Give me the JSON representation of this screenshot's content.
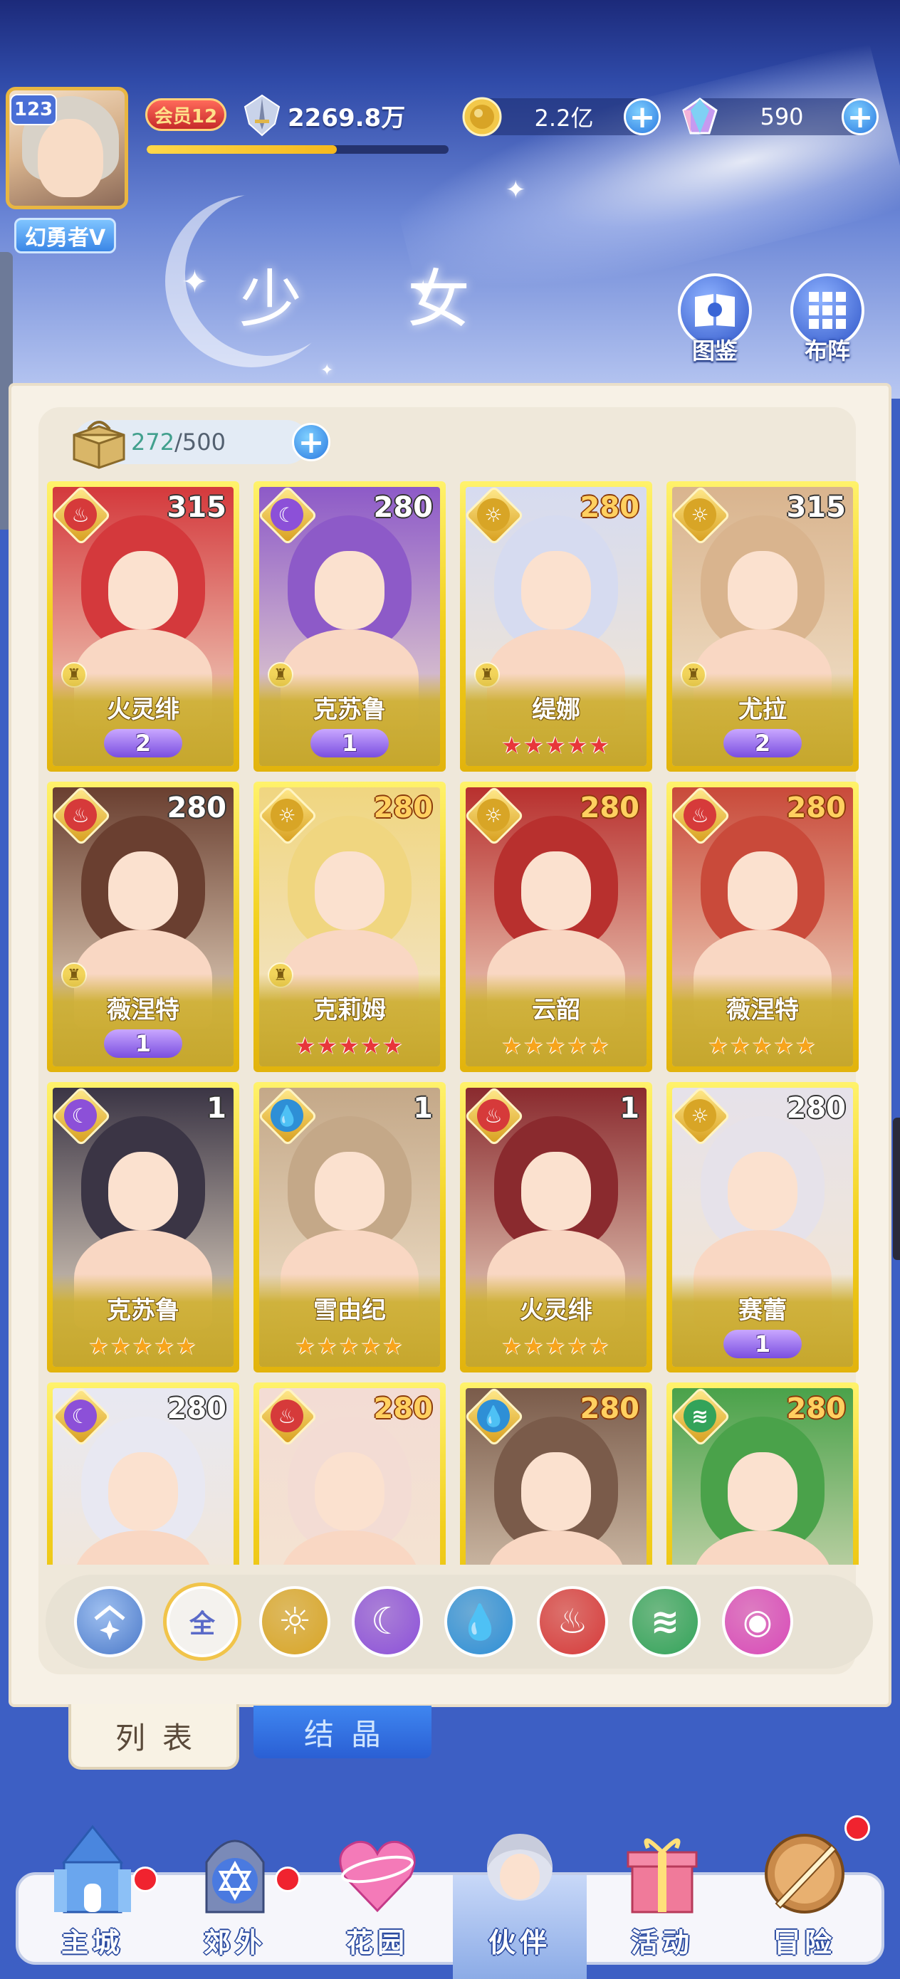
{
  "page": {
    "title": "少 女"
  },
  "player": {
    "level": "123",
    "name": "幻勇者V",
    "vip": "会员12",
    "power": "2269.8万",
    "exp_fraction": 0.63
  },
  "currencies": {
    "gold": {
      "value": "2.2亿",
      "icon": "gold-coin-icon"
    },
    "gems": {
      "value": "590",
      "icon": "crystal-gem-icon"
    }
  },
  "side_buttons": {
    "codex": "图鉴",
    "formation": "布阵"
  },
  "capacity": {
    "current": "272",
    "separator": "/",
    "max": "500"
  },
  "elements": {
    "all": {
      "label": "全",
      "color": "#6e7ed0"
    },
    "light": {
      "icon": "sun-icon",
      "color": "#d8a526"
    },
    "dark": {
      "icon": "moon-icon",
      "color": "#8c50d8"
    },
    "water": {
      "icon": "water-drop-icon",
      "color": "#2e8fd6"
    },
    "fire": {
      "icon": "fire-icon",
      "color": "#d63a3a"
    },
    "wind": {
      "icon": "wind-icon",
      "color": "#33a35a"
    },
    "chaos": {
      "icon": "orbit-icon",
      "color": "#d84ab8"
    }
  },
  "girls": [
    {
      "name": "火灵绯",
      "level": "315",
      "element": "fire",
      "rank": "2",
      "stars": null,
      "bg": "#d4393c"
    },
    {
      "name": "克苏鲁",
      "level": "280",
      "element": "dark",
      "rank": "1",
      "stars": null,
      "bg": "#8d5ac8"
    },
    {
      "name": "缇娜",
      "level": "280",
      "element": "light",
      "rank": null,
      "stars": "★★★★★",
      "star_color": "red",
      "bg": "#d6dbf0"
    },
    {
      "name": "尤拉",
      "level": "315",
      "element": "light",
      "rank": "2",
      "stars": null,
      "bg": "#d9b48e"
    },
    {
      "name": "薇涅特",
      "level": "280",
      "element": "fire",
      "rank": "1",
      "stars": null,
      "bg": "#6a3f30"
    },
    {
      "name": "克莉姆",
      "level": "280",
      "element": "light",
      "rank": null,
      "stars": "★★★★★",
      "star_color": "red",
      "bg": "#f0d680"
    },
    {
      "name": "云韶",
      "level": "280",
      "element": "light",
      "rank": null,
      "stars": "★★★★★",
      "star_color": "gold",
      "bg": "#b8302e"
    },
    {
      "name": "薇涅特",
      "level": "280",
      "element": "fire",
      "rank": null,
      "stars": "★★★★★",
      "star_color": "gold",
      "bg": "#c94a3a"
    },
    {
      "name": "克苏鲁",
      "level": "1",
      "element": "dark",
      "rank": null,
      "stars": "★★★★★",
      "star_color": "gold",
      "bg": "#3b3545"
    },
    {
      "name": "雪由纪",
      "level": "1",
      "element": "water",
      "rank": null,
      "stars": "★★★★★",
      "star_color": "gold",
      "bg": "#c4a888"
    },
    {
      "name": "火灵绯",
      "level": "1",
      "element": "fire",
      "rank": null,
      "stars": "★★★★★",
      "star_color": "gold",
      "bg": "#8a2a2e"
    },
    {
      "name": "赛蕾",
      "level": "280",
      "element": "light",
      "rank": "1",
      "stars": null,
      "bg": "#e6e2ea"
    },
    {
      "name": "",
      "level": "280",
      "element": "dark",
      "rank": null,
      "stars": null,
      "bg": "#e8e8f2"
    },
    {
      "name": "",
      "level": "280",
      "element": "fire",
      "rank": null,
      "stars": null,
      "bg": "#f3dcd4"
    },
    {
      "name": "",
      "level": "280",
      "element": "water",
      "rank": null,
      "stars": null,
      "bg": "#7a5b4a"
    },
    {
      "name": "",
      "level": "280",
      "element": "wind",
      "rank": null,
      "stars": null,
      "bg": "#4aa24a"
    }
  ],
  "tabs": {
    "list": "列表",
    "crystal": "结晶"
  },
  "nav": [
    {
      "label": "主城",
      "icon": "castle-icon",
      "dot": true
    },
    {
      "label": "郊外",
      "icon": "magic-gate-icon",
      "dot": true
    },
    {
      "label": "花园",
      "icon": "heart-icon",
      "dot": false
    },
    {
      "label": "伙伴",
      "icon": "companion-icon",
      "dot": false,
      "active": true
    },
    {
      "label": "活动",
      "icon": "gift-box-icon",
      "dot": false
    },
    {
      "label": "冒险",
      "icon": "compass-sword-icon",
      "dot": true
    }
  ]
}
